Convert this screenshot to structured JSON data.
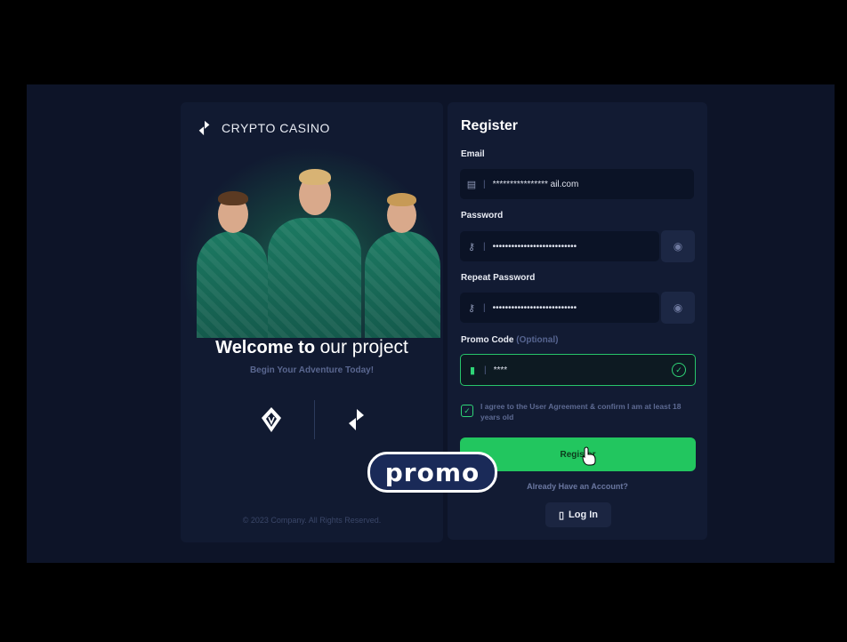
{
  "brand": {
    "name": "CRYPTO CASINO"
  },
  "hero": {
    "welcome_bold": "Welcome to",
    "welcome_light": "our project",
    "tagline": "Begin Your Adventure Today!",
    "copyright": "© 2023 Company. All Rights Reserved."
  },
  "form": {
    "title": "Register",
    "email_label": "Email",
    "email_value": "**************** ail.com",
    "password_label": "Password",
    "password_value": "•••••••••••••••••••••••••••",
    "repeat_label": "Repeat Password",
    "repeat_value": "•••••••••••••••••••••••••••",
    "promo_label": "Promo Code",
    "promo_optional": "(Optional)",
    "promo_value": "****",
    "agree_text": "I agree to the User Agreement & confirm I am at least 18 years old",
    "register_label": "Register",
    "have_account": "Already Have an Account?",
    "login_label": "Log In"
  },
  "overlay": {
    "promo_text": "promo"
  },
  "colors": {
    "accent": "#22c65f",
    "panel": "#121b33",
    "background": "#0d1428"
  },
  "icons": [
    "casino-logo-icon",
    "email-icon",
    "key-icon",
    "eye-icon",
    "promo-tag-icon",
    "check-icon",
    "club-crest-icon",
    "login-icon",
    "cursor-hand-icon"
  ]
}
